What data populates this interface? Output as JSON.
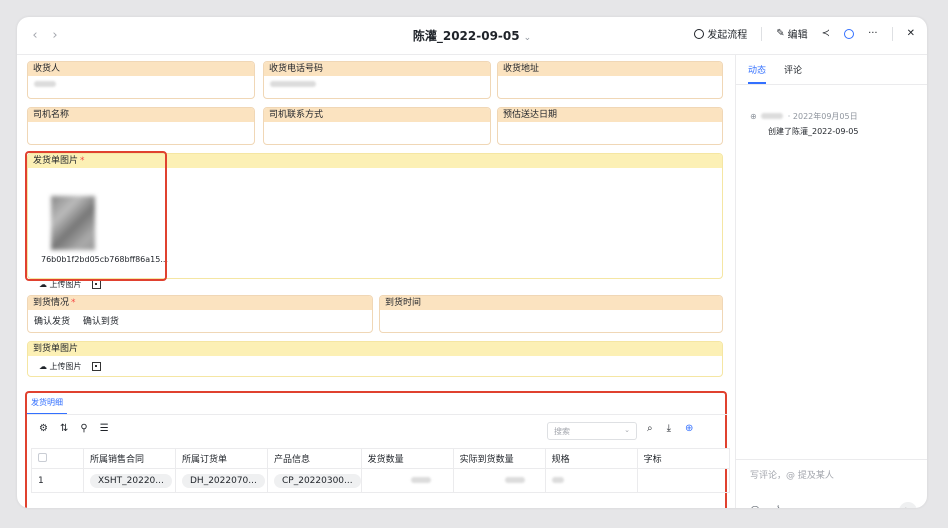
{
  "header": {
    "back": "‹",
    "forward": "›",
    "title": "陈灌_2022-09-05",
    "title_chevron": "⌄",
    "actions": {
      "start_flow": "发起流程",
      "edit": "编辑",
      "share_icon": "share-icon",
      "history_icon": "clock-icon",
      "more": "···",
      "close": "✕"
    }
  },
  "form": {
    "row1": [
      {
        "label": "收货人"
      },
      {
        "label": "收货电话号码"
      },
      {
        "label": "收货地址"
      }
    ],
    "row2": [
      {
        "label": "司机名称"
      },
      {
        "label": "司机联系方式"
      },
      {
        "label": "预估送达日期"
      }
    ],
    "delivery_image": {
      "label": "发货单图片",
      "required_mark": "*",
      "file_name": "76b0b1f2bd05cb768bff86a15...",
      "upload_label": "上传图片"
    },
    "arrival_status": {
      "label": "到货情况",
      "required_mark": "*",
      "options": [
        "确认发货",
        "确认到货"
      ]
    },
    "arrival_time": {
      "label": "到货时间"
    },
    "arrival_image": {
      "label": "到货单图片",
      "upload_label": "上传图片"
    }
  },
  "details": {
    "tab": "发货明细",
    "search_placeholder": "搜索",
    "columns": [
      "所属销售合同",
      "所属订货单",
      "产品信息",
      "发货数量",
      "实际到货数量",
      "规格",
      "字标"
    ],
    "rows": [
      {
        "index": "1",
        "contract": "XSHT_20220...",
        "order": "DH_2022070...",
        "product": "CP_20220300..."
      }
    ]
  },
  "side_panel": {
    "tabs": [
      "动态",
      "评论"
    ],
    "activity_date": "· 2022年09月05日",
    "activity_text": "创建了陈灌_2022-09-05",
    "comment_placeholder": "写评论，@ 提及某人"
  },
  "colors": {
    "accent": "#3370ff",
    "highlight_border": "#e0412f",
    "label_orange": "#fbe3c0",
    "label_yellow": "#fcf0b5"
  }
}
